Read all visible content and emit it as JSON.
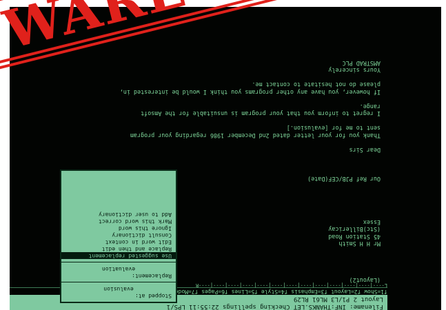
{
  "banner": {
    "text": "WARE",
    "color": "#e0211b"
  },
  "status_bar": {
    "line1": "Filename: INF:THANKS.LET   Checking spellings   22:55:11   LPS/1",
    "line2": "Layout 2   P1/L3   ML61   RL29",
    "line3": "f1=Show  f2=Layout  f3=Emphasis  f4=Style  f5=Lines  f6=Pages  f7=Modes  f8=Blocks  EXIT"
  },
  "ruler": "L----|----|----|----|----|----|----|----|----|----|----|----|----R",
  "spell_panel": {
    "stopped_label": "Stopped at:",
    "stopped_word": "evalusion",
    "replacement_label": "Replacement:",
    "replacement_word": "evaluation",
    "menu": [
      "Use suggested replacement",
      "Replace and then edit",
      "Edit word in context",
      "Consult dictionary",
      "Ignore this word",
      "Mark this word correct",
      "Add to user dictionary"
    ]
  },
  "document": {
    "lines": [
      "(Layout2)",
      "",
      "",
      "",
      "",
      "Mr H H Smith",
      "45 Station Road",
      "(Stc)Billericay",
      "Essex",
      "",
      "",
      "",
      "",
      "",
      "Our Ref PJB/CEF(Date)",
      "",
      "",
      "",
      "Dear Sirs",
      "",
      "Thank you for your letter dated 2nd December 1986 regarding your program",
      "sent to me for [evalusion.]",
      "",
      "I regret to inform you that your program is unsuitable for the Amsoft",
      "range.",
      "",
      "If however, you have any other programs you think I would be interested in,",
      "please do not hesitate to contact me.",
      "",
      "Yours sincerely",
      "AMSTRAD PLC"
    ]
  }
}
